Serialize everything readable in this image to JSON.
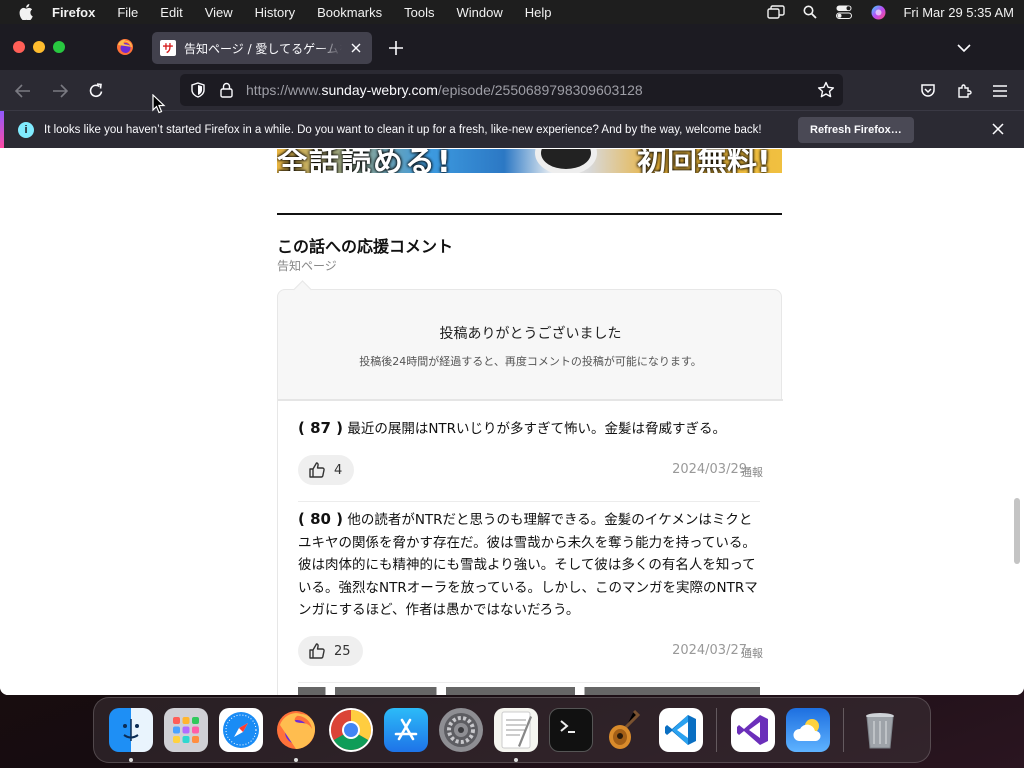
{
  "menubar": {
    "app_name": "Firefox",
    "items": [
      "File",
      "Edit",
      "View",
      "History",
      "Bookmarks",
      "Tools",
      "Window",
      "Help"
    ],
    "clock": "Fri Mar 29  5:35 AM"
  },
  "browser": {
    "tab_title": "告知ページ / 愛してるゲームを終わらせたい",
    "url_prefix": "https://www.",
    "url_domain": "sunday-webry.com",
    "url_path": "/episode/2550689798309603128",
    "notification_text": "It looks like you haven’t started Firefox in a while. Do you want to clean it up for a fresh, like-new experience? And by the way, welcome back!",
    "notification_button": "Refresh Firefox…"
  },
  "page": {
    "banner_left": "全話読める!",
    "banner_right": "初回無料!",
    "section_title": "この話への応援コメント",
    "section_subtitle": "告知ページ",
    "thanks_title": "投稿ありがとうございました",
    "thanks_subtitle": "投稿後24時間が経過すると、再度コメントの投稿が可能になります。",
    "comments": [
      {
        "number": "( 87 )",
        "text": "最近の展開はNTRいじりが多すぎて怖い。金髪は脅威すぎる。",
        "likes": "4",
        "date": "2024/03/29",
        "report": "通報"
      },
      {
        "number": "( 80 )",
        "text": "他の読者がNTRだと思うのも理解できる。金髪のイケメンはミクとユキヤの関係を脅かす存在だ。彼は雪哉から未久を奪う能力を持っている。彼は肉体的にも精神的にも雪哉より強い。そして彼は多くの有名人を知っている。強烈なNTRオーラを放っている。しかし、このマンガを実際のNTRマンガにするほど、作者は愚かではないだろう。",
        "likes": "25",
        "date": "2024/03/27",
        "report": "通報"
      }
    ]
  },
  "dock": {
    "apps": [
      "Finder",
      "Launchpad",
      "Safari",
      "Firefox",
      "Google Chrome",
      "App Store",
      "System Preferences",
      "TextEdit",
      "Terminal",
      "GarageBand",
      "Visual Studio Code",
      "Visual Studio",
      "Weather",
      "Trash"
    ]
  },
  "colors": {
    "menubar_bg": "#1e1e1e",
    "tabbar_bg": "#1c1b22",
    "toolbar_bg": "#2b2a33",
    "accent": "#9059ff"
  }
}
